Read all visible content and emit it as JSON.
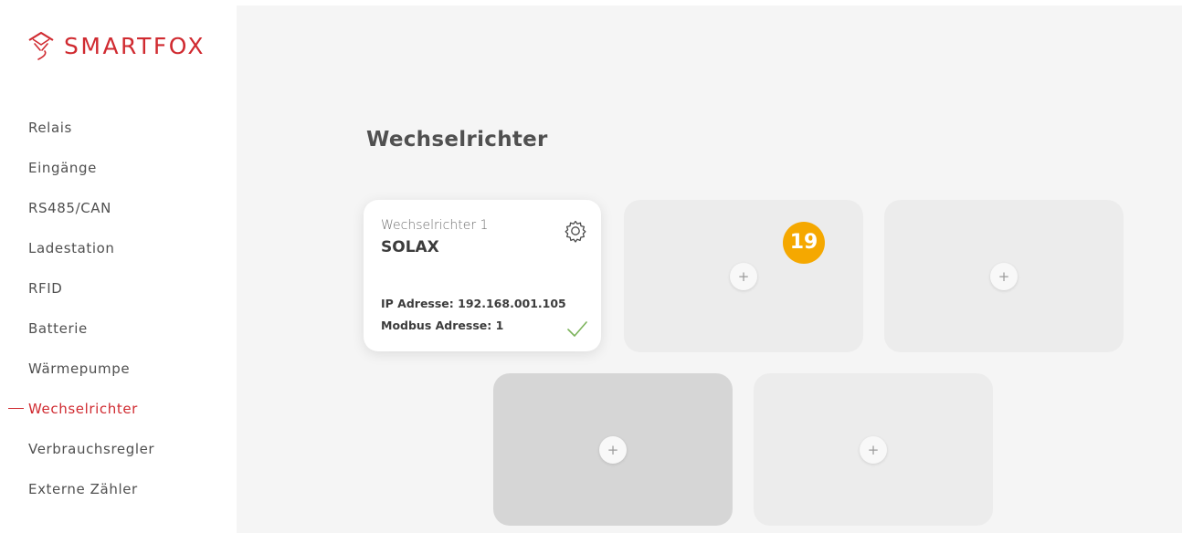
{
  "brand": {
    "name": "SMARTFOX",
    "color": "#d02a30"
  },
  "sidebar": {
    "items": [
      {
        "label": "Relais"
      },
      {
        "label": "Eingänge"
      },
      {
        "label": "RS485/CAN"
      },
      {
        "label": "Ladestation"
      },
      {
        "label": "RFID"
      },
      {
        "label": "Batterie"
      },
      {
        "label": "Wärmepumpe"
      },
      {
        "label": "Wechselrichter",
        "active": true
      },
      {
        "label": "Verbrauchsregler"
      },
      {
        "label": "Externe Zähler"
      }
    ]
  },
  "main": {
    "title": "Wechselrichter",
    "inverter": {
      "subtitle": "Wechselrichter 1",
      "name": "SOLAX",
      "ip": "IP Adresse: 192.168.001.105",
      "modbus": "Modbus Adresse: 1",
      "status_icon": "check-icon",
      "settings_icon": "gear-icon"
    },
    "add_label": "+",
    "step_badge": "19",
    "badge_color": "#f5a800"
  }
}
